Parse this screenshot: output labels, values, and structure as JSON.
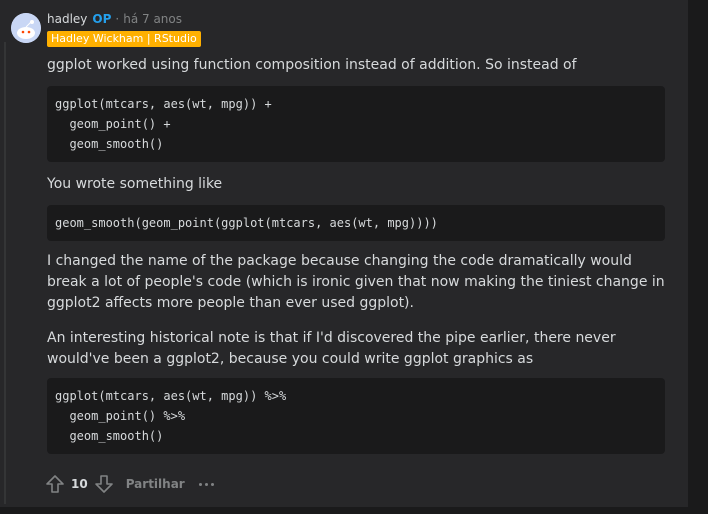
{
  "comment": {
    "author": "hadley",
    "op_badge": "OP",
    "separator": "·",
    "time": "há 7 anos",
    "flair": "Hadley Wickham | RStudio",
    "paragraphs": {
      "p1": "ggplot worked using function composition instead of addition. So instead of",
      "p2": "You wrote something like",
      "p3": "I changed the name of the package because changing the code dramatically would break a lot of people's code (which is ironic given that now making the tiniest change in ggplot2 affects more people than ever used ggplot).",
      "p4": "An interesting historical note is that if I'd discovered the pipe earlier, there never would've been a ggplot2, because you could write ggplot graphics as"
    },
    "code_blocks": {
      "c1": "ggplot(mtcars, aes(wt, mpg)) +\n  geom_point() +\n  geom_smooth()",
      "c2": "geom_smooth(geom_point(ggplot(mtcars, aes(wt, mpg))))",
      "c3": "ggplot(mtcars, aes(wt, mpg)) %>%\n  geom_point() %>%\n  geom_smooth()"
    }
  },
  "actions": {
    "score": "10",
    "share_label": "Partilhar"
  },
  "icons": {
    "avatar": "snoo-avatar-icon",
    "upvote": "upvote-arrow-icon",
    "downvote": "downvote-arrow-icon",
    "more": "more-options-icon"
  },
  "colors": {
    "background": "#1a1a1b",
    "card": "#272729",
    "op": "#24a0ed",
    "flair": "#ffb000"
  }
}
